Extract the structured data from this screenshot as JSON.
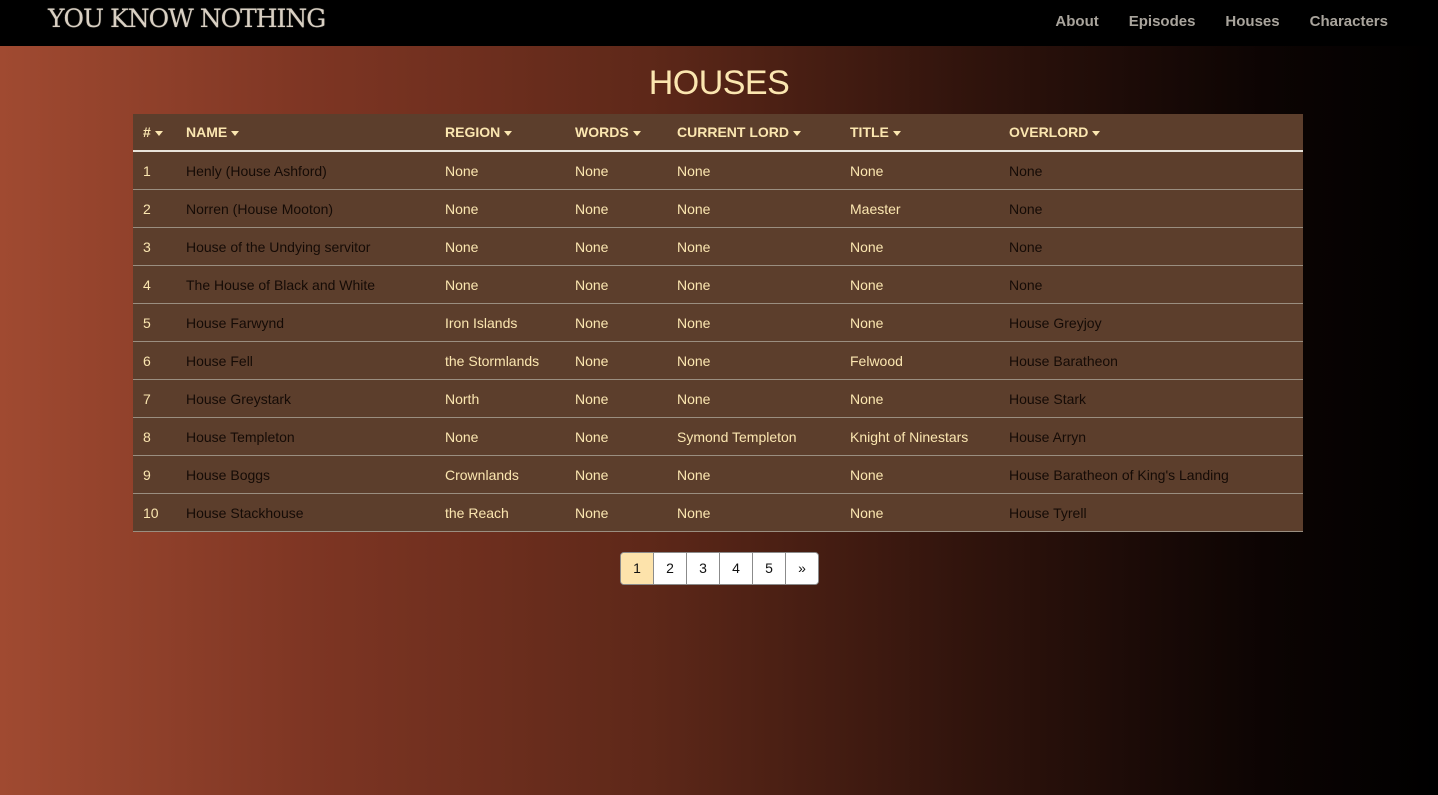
{
  "navbar": {
    "brand": "YOU KNOW NOTHING",
    "links": [
      "About",
      "Episodes",
      "Houses",
      "Characters"
    ]
  },
  "page": {
    "title": "HOUSES"
  },
  "table": {
    "columns": [
      "#",
      "NAME",
      "REGION",
      "WORDS",
      "CURRENT LORD",
      "TITLE",
      "OVERLORD"
    ],
    "rows": [
      [
        "1",
        "Henly (House Ashford)",
        "None",
        "None",
        "None",
        "None",
        "None"
      ],
      [
        "2",
        "Norren (House Mooton)",
        "None",
        "None",
        "None",
        "Maester",
        "None"
      ],
      [
        "3",
        "House of the Undying servitor",
        "None",
        "None",
        "None",
        "None",
        "None"
      ],
      [
        "4",
        "The House of Black and White",
        "None",
        "None",
        "None",
        "None",
        "None"
      ],
      [
        "5",
        "House Farwynd",
        "Iron Islands",
        "None",
        "None",
        "None",
        "House Greyjoy"
      ],
      [
        "6",
        "House Fell",
        "the Stormlands",
        "None",
        "None",
        "Felwood",
        "House Baratheon"
      ],
      [
        "7",
        "House Greystark",
        "North",
        "None",
        "None",
        "None",
        "House Stark"
      ],
      [
        "8",
        "House Templeton",
        "None",
        "None",
        "Symond Templeton",
        "Knight of Ninestars",
        "House Arryn"
      ],
      [
        "9",
        "House Boggs",
        "Crownlands",
        "None",
        "None",
        "None",
        "House Baratheon of King's Landing"
      ],
      [
        "10",
        "House Stackhouse",
        "the Reach",
        "None",
        "None",
        "None",
        "House Tyrell"
      ]
    ]
  },
  "pagination": {
    "pages": [
      "1",
      "2",
      "3",
      "4",
      "5",
      "»"
    ],
    "active": "1"
  },
  "colors": {
    "accent_text": "#fbe6b0",
    "dark_text": "#150b06",
    "table_bg": "#5c3e2c",
    "active_page": "#fde3ab"
  }
}
